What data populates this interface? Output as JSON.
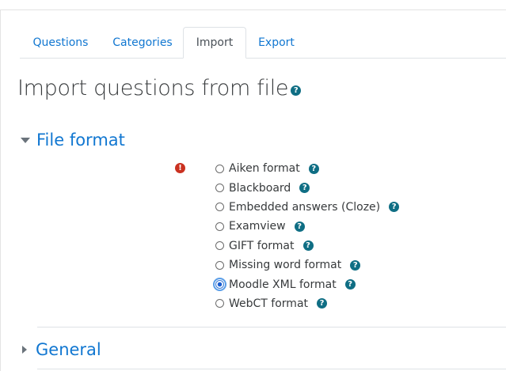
{
  "tabs": [
    {
      "label": "Questions",
      "active": false
    },
    {
      "label": "Categories",
      "active": false
    },
    {
      "label": "Import",
      "active": true
    },
    {
      "label": "Export",
      "active": false
    }
  ],
  "page_title": "Import questions from file",
  "sections": {
    "file_format": {
      "title": "File format",
      "expanded": true
    },
    "general": {
      "title": "General",
      "expanded": false
    }
  },
  "formats": [
    {
      "label": "Aiken format",
      "checked": false
    },
    {
      "label": "Blackboard",
      "checked": false
    },
    {
      "label": "Embedded answers (Cloze)",
      "checked": false
    },
    {
      "label": "Examview",
      "checked": false
    },
    {
      "label": "GIFT format",
      "checked": false
    },
    {
      "label": "Missing word format",
      "checked": false
    },
    {
      "label": "Moodle XML format",
      "checked": true
    },
    {
      "label": "WebCT format",
      "checked": false
    }
  ],
  "icons": {
    "help": "question-circle-icon",
    "required": "exclamation-circle-icon"
  },
  "colors": {
    "link": "#1177d1",
    "help": "#0f6e84",
    "required": "#ca3120"
  }
}
